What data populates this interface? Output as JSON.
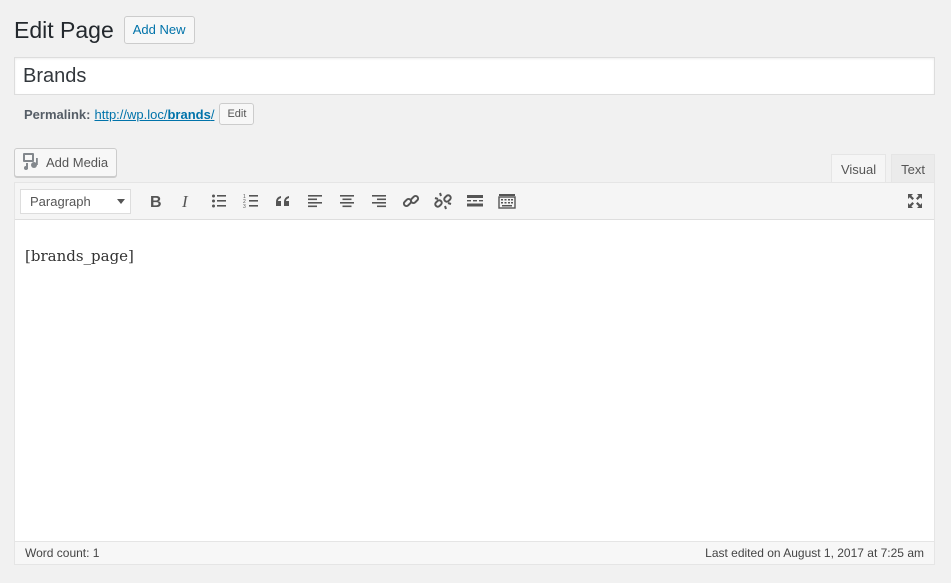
{
  "header": {
    "title": "Edit Page",
    "add_new_label": "Add New"
  },
  "post": {
    "title": "Brands"
  },
  "permalink": {
    "label": "Permalink:",
    "url_prefix": "http://wp.loc/",
    "slug": "brands",
    "url_suffix": "/",
    "edit_label": "Edit"
  },
  "media": {
    "add_media_label": "Add Media",
    "icon": "media-icon"
  },
  "editor_tabs": [
    {
      "label": "Visual",
      "active": true
    },
    {
      "label": "Text",
      "active": false
    }
  ],
  "toolbar": {
    "format_value": "Paragraph",
    "buttons": [
      "bold-icon",
      "italic-icon",
      "bullet-list-icon",
      "numbered-list-icon",
      "blockquote-icon",
      "align-left-icon",
      "align-center-icon",
      "align-right-icon",
      "link-icon",
      "unlink-icon",
      "read-more-icon",
      "toolbar-toggle-icon"
    ],
    "fullscreen_icon": "fullscreen-icon"
  },
  "content": {
    "body": "[brands_page]"
  },
  "status": {
    "word_count": "Word count: 1",
    "last_edited": "Last edited on August 1, 2017 at 7:25 am"
  },
  "colors": {
    "link": "#0073aa",
    "background": "#f1f1f1",
    "toolbar": "#f5f5f5"
  }
}
